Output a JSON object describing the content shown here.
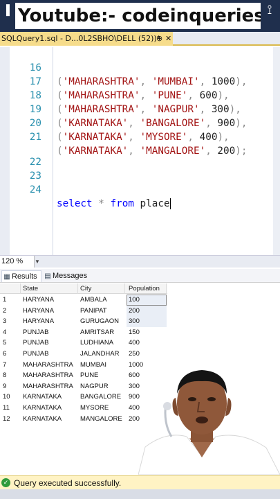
{
  "banner": {
    "title": "Youtube:- codeinqueries"
  },
  "tab": {
    "label": "SQLQuery1.sql - D...0L2SBHO\\DELL (52))*",
    "pin": "⊕",
    "close": "✕"
  },
  "editor": {
    "lines": [
      {
        "num": "16",
        "state": "'MAHARASHTRA'",
        "city": "'MUMBAI'",
        "pop": "1000",
        "end": "),"
      },
      {
        "num": "17",
        "state": "'MAHARASHTRA'",
        "city": "'PUNE'",
        "pop": "600",
        "end": "),"
      },
      {
        "num": "18",
        "state": "'MAHARASHTRA'",
        "city": "'NAGPUR'",
        "pop": "300",
        "end": "),"
      },
      {
        "num": "19",
        "state": "'KARNATAKA'",
        "city": "'BANGALORE'",
        "pop": "900",
        "end": "),"
      },
      {
        "num": "20",
        "state": "'KARNATAKA'",
        "city": "'MYSORE'",
        "pop": "400",
        "end": "),"
      },
      {
        "num": "21",
        "state": "'KARNATAKA'",
        "city": "'MANGALORE'",
        "pop": "200",
        "end": ");"
      }
    ],
    "line22": "22",
    "line23": "23",
    "line24": {
      "num": "24",
      "kw1": "select",
      "star": "*",
      "kw2": "from",
      "table": "place"
    }
  },
  "zoom": {
    "value": "120 %"
  },
  "results_tabs": {
    "results": "Results",
    "messages": "Messages"
  },
  "grid": {
    "headers": [
      "State",
      "City",
      "Population"
    ],
    "rows": [
      [
        "1",
        "HARYANA",
        "AMBALA",
        "100"
      ],
      [
        "2",
        "HARYANA",
        "PANIPAT",
        "200"
      ],
      [
        "3",
        "HARYANA",
        "GURUGAON",
        "300"
      ],
      [
        "4",
        "PUNJAB",
        "AMRITSAR",
        "150"
      ],
      [
        "5",
        "PUNJAB",
        "LUDHIANA",
        "400"
      ],
      [
        "6",
        "PUNJAB",
        "JALANDHAR",
        "250"
      ],
      [
        "7",
        "MAHARASHTRA",
        "MUMBAI",
        "1000"
      ],
      [
        "8",
        "MAHARASHTRA",
        "PUNE",
        "600"
      ],
      [
        "9",
        "MAHARASHTRA",
        "NAGPUR",
        "300"
      ],
      [
        "10",
        "KARNATAKA",
        "BANGALORE",
        "900"
      ],
      [
        "11",
        "KARNATAKA",
        "MYSORE",
        "400"
      ],
      [
        "12",
        "KARNATAKA",
        "MANGALORE",
        "200"
      ]
    ]
  },
  "status": {
    "text": "Query executed successfully."
  },
  "colors": {
    "banner_bg": "#1f2f4d",
    "tab_active": "#f6dc8b",
    "status_bg": "#fff3c4",
    "keyword": "#0000ff",
    "string": "#a31515",
    "line_number": "#2b91af"
  }
}
